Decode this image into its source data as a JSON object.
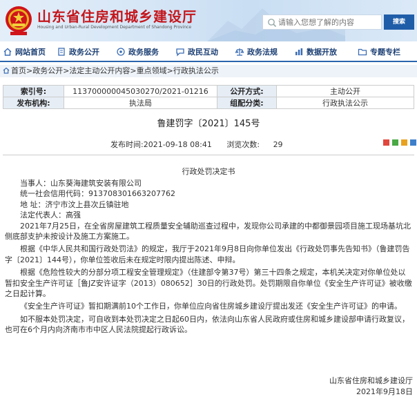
{
  "header": {
    "title": "山东省住房和城乡建设厅",
    "subtitle": "Housing and Urban-Rural Development Department of Shandong Province",
    "search_placeholder": "请输入您想了解的内容",
    "search_button": "搜索"
  },
  "nav": [
    {
      "label": "网站首页",
      "icon": "home-icon"
    },
    {
      "label": "政务公开",
      "icon": "document-icon"
    },
    {
      "label": "政务服务",
      "icon": "service-icon"
    },
    {
      "label": "政民互动",
      "icon": "chat-icon"
    },
    {
      "label": "政务法规",
      "icon": "law-icon"
    },
    {
      "label": "数据开放",
      "icon": "chart-icon"
    },
    {
      "label": "专题专栏",
      "icon": "folder-icon"
    }
  ],
  "breadcrumb": "首页>政务公开>法定主动公开内容>重点领域>行政执法公示",
  "meta": {
    "index_label": "索引号:",
    "index_value": "113700000045030270/2021-01216",
    "open_label": "公开方式:",
    "open_value": "主动公开",
    "org_label": "发布机构:",
    "org_value": "执法局",
    "cat_label": "组配分类:",
    "cat_value": "行政执法公示"
  },
  "doc_number": "鲁建罚字〔2021〕145号",
  "publish_time": "发布时间:2021-09-18 08:41",
  "views_label": "浏览次数:",
  "views_value": "29",
  "doc_title": "行政处罚决定书",
  "body": [
    "当事人：山东葵海建筑安装有限公司",
    "统一社会信用代码：913708301663207762",
    "地 址：济宁市汶上县次丘镇驻地",
    "法定代表人：高强",
    "2021年7月25日，在全省房屋建筑工程质量安全辅助巡查过程中，发现你公司承建的中都御景园项目施工现场基坑北侧底部支护未按设计及施工方案施工。",
    "根据《中华人民共和国行政处罚法》的规定，我厅于2021年9月8日向你单位发出《行政处罚事先告知书》（鲁建罚告字〔2021〕144号），你单位签收后未在规定时限内提出陈述、申辩。",
    "根据《危险性较大的分部分项工程安全管理规定》（住建部令第37号）第三十四条之规定，本机关决定对你单位处以暂扣安全生产许可证［鲁JZ安许证字（2013）080652］30日的行政处罚。处罚期限自你单位《安全生产许可证》被收缴之日起计算。",
    "《安全生产许可证》暂扣期满前10个工作日，你单位应向省住房城乡建设厅提出发还《安全生产许可证》的申请。",
    "如不服本处罚决定，可自收到本处罚决定之日起60日内，依法向山东省人民政府或住房和城乡建设部申请行政复议，也可在6个月内向济南市市中区人民法院提起行政诉讼。"
  ],
  "signature": {
    "org": "山东省住房和城乡建设厅",
    "date": "2021年9月18日"
  },
  "colors": {
    "title_red": "#c4161c",
    "nav_blue": "#1b3f74",
    "accent_blue": "#1f5da8"
  }
}
